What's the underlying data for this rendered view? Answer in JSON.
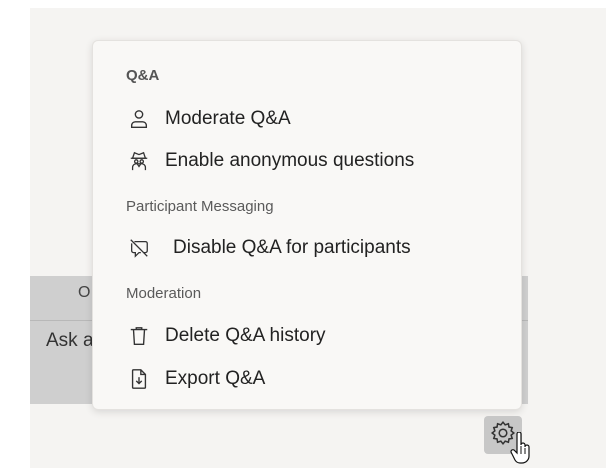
{
  "background": {
    "partial_label_top": "O",
    "partial_label_ask": "Ask a"
  },
  "menu": {
    "sections": [
      {
        "header": "Q&A",
        "items": [
          {
            "label": "Moderate Q&A",
            "icon": "person-icon"
          },
          {
            "label": "Enable anonymous questions",
            "icon": "anonymous-icon"
          }
        ]
      },
      {
        "header": "Participant Messaging",
        "items": [
          {
            "label": "Disable Q&A for participants",
            "icon": "chat-off-icon"
          }
        ]
      },
      {
        "header": "Moderation",
        "items": [
          {
            "label": "Delete Q&A history",
            "icon": "trash-icon"
          },
          {
            "label": "Export Q&A",
            "icon": "export-icon"
          }
        ]
      }
    ]
  },
  "settings_button": {
    "icon": "gear-icon"
  },
  "colors": {
    "menu_bg": "#f9f8f6",
    "panel_bg": "#f5f4f2",
    "gray_block": "#cfcfcf",
    "gear_btn_bg": "#c7c7c7"
  }
}
